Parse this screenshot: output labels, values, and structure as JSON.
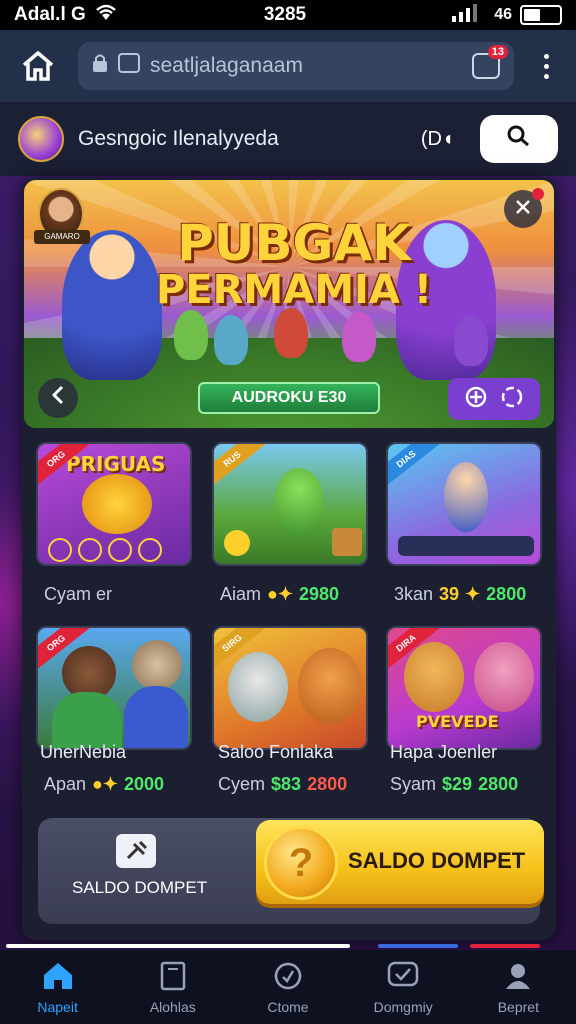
{
  "status_bar": {
    "carrier": "Adal.l G",
    "time": "3285",
    "right_text": "46"
  },
  "browser": {
    "url": "seatljalaganaam",
    "tab_badge": "13"
  },
  "site_header": {
    "title": "Gesngoic Ilenalyyeda",
    "sound_label": "(D◖"
  },
  "banner": {
    "title_line1": "PUBGAK",
    "title_line2": "PERMAMIA !",
    "cta_label": "AUDROKU E30",
    "avatar_label": "GAMARO"
  },
  "games": [
    {
      "ribbon": "ORG",
      "art_text": "PRIGUAS",
      "name": "Cyam er",
      "price_label": "",
      "amount": ""
    },
    {
      "ribbon": "RUS",
      "art_text": "",
      "name": "Aiam",
      "price_label": "",
      "amount": "2980"
    },
    {
      "ribbon": "DIAS",
      "art_text": "",
      "name": "3kan",
      "price_label": "39",
      "amount": "2800"
    },
    {
      "ribbon": "ORG",
      "art_text": "",
      "name": "UnerNebia",
      "price_label": "Apan",
      "amount": "2000"
    },
    {
      "ribbon": "SIRG",
      "art_text": "",
      "name": "Saloo Fonlaka",
      "price_label": "Cyem",
      "amount": "2800",
      "currency": "$83"
    },
    {
      "ribbon": "DIRA",
      "art_text": "PVEVEDE",
      "name": "Hapa Joenler",
      "price_label": "Syam",
      "amount": "2800",
      "currency": "$29"
    }
  ],
  "wallet": {
    "label": "SALDO DOMPET",
    "cta_label": "SALDO DOMPET",
    "coin_symbol": "?"
  },
  "bottom_nav": [
    {
      "label": "Napeit",
      "icon": "home-icon",
      "active": true
    },
    {
      "label": "Alohlas",
      "icon": "book-icon",
      "active": false
    },
    {
      "label": "Ctome",
      "icon": "clock-icon",
      "active": false
    },
    {
      "label": "Domgmiy",
      "icon": "chat-icon",
      "active": false
    },
    {
      "label": "Bepret",
      "icon": "profile-icon",
      "active": false
    }
  ],
  "colors": {
    "accent_blue": "#2ea3ff",
    "amount_green": "#4ee86a",
    "amount_red": "#ff5a4a",
    "cta_yellow": "#f5c11a",
    "badge_red": "#e0223a"
  }
}
